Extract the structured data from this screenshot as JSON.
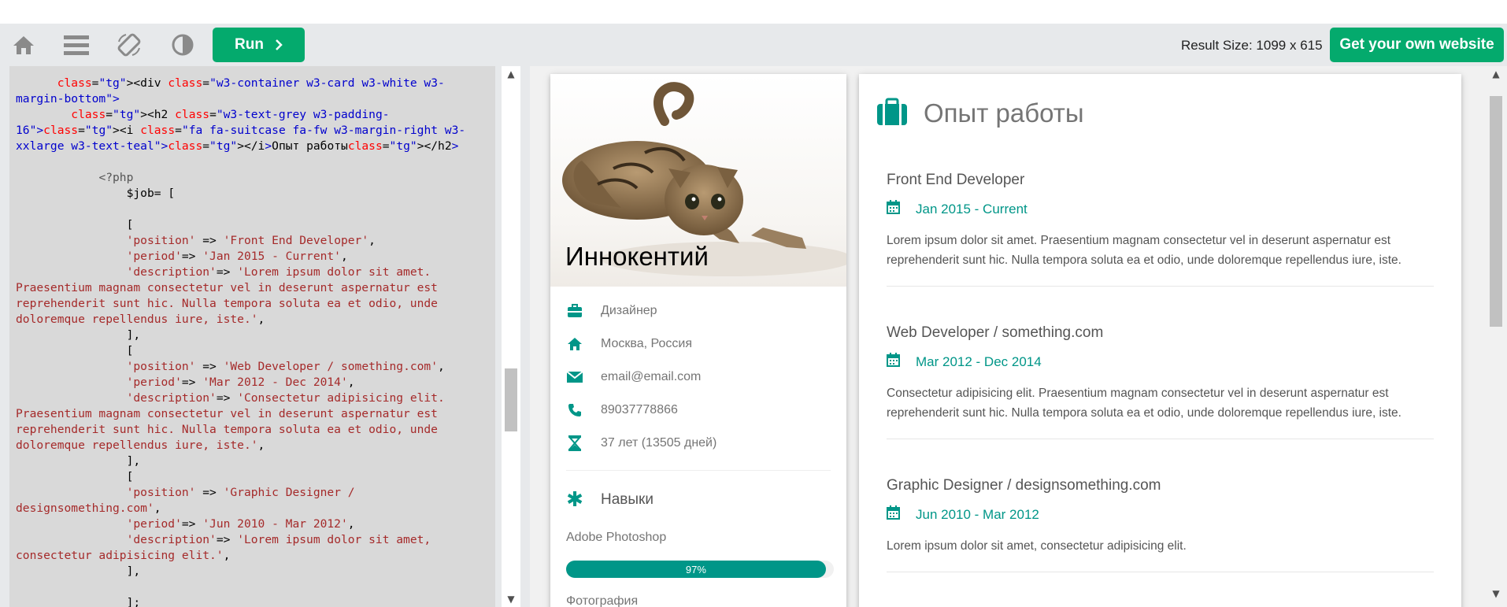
{
  "toolbar": {
    "home_icon": "home-icon",
    "menu_icon": "menu-icon",
    "rotate_icon": "rotate-icon",
    "contrast_icon": "contrast-icon",
    "run_label": "Run",
    "result_size": "Result Size: 1099 x 615",
    "get_website_label": "Get your own website"
  },
  "code": {
    "lines": [
      "      <div class=\"w3-container w3-card w3-white w3-margin-bottom\">",
      "        <h2 class=\"w3-text-grey w3-padding-16\"><i class=\"fa fa-suitcase fa-fw w3-margin-right w3-xxlarge w3-text-teal\"></i>Опыт работы</h2>",
      "",
      "            <?php",
      "                $job= [",
      "",
      "                [",
      "                'position' => 'Front End Developer',",
      "                'period'=> 'Jan 2015 - Current',",
      "                'description'=> 'Lorem ipsum dolor sit amet. Praesentium magnam consectetur vel in deserunt aspernatur est reprehenderit sunt hic. Nulla tempora soluta ea et odio, unde doloremque repellendus iure, iste.',",
      "                ],",
      "                [",
      "                'position' => 'Web Developer / something.com',",
      "                'period'=> 'Mar 2012 - Dec 2014',",
      "                'description'=> 'Consectetur adipisicing elit. Praesentium magnam consectetur vel in deserunt aspernatur est reprehenderit sunt hic. Nulla tempora soluta ea et odio, unde doloremque repellendus iure, iste.',",
      "                ],",
      "                [",
      "                'position' => 'Graphic Designer / designsomething.com',",
      "                'period'=> 'Jun 2010 - Mar 2012',",
      "                'description'=> 'Lorem ipsum dolor sit amet, consectetur adipisicing elit.',",
      "                ],",
      "",
      "                ];"
    ]
  },
  "profile": {
    "name": "Иннокентий",
    "info": [
      {
        "icon": "briefcase-icon",
        "text": "Дизайнер"
      },
      {
        "icon": "home-icon",
        "text": "Москва, Россия"
      },
      {
        "icon": "envelope-icon",
        "text": "email@email.com"
      },
      {
        "icon": "phone-icon",
        "text": "89037778866"
      },
      {
        "icon": "hourglass-icon",
        "text": "37 лет (13505 дней)"
      }
    ],
    "skills_title": "Навыки",
    "skills": [
      {
        "name": "Adobe Photoshop",
        "percent": 97,
        "label": "97%"
      },
      {
        "name": "Фотография"
      }
    ]
  },
  "experience": {
    "title": "Опыт работы",
    "jobs": [
      {
        "position": "Front End Developer",
        "period": "Jan 2015 - Current",
        "description": "Lorem ipsum dolor sit amet. Praesentium magnam consectetur vel in deserunt aspernatur est reprehenderit sunt hic. Nulla tempora soluta ea et odio, unde doloremque repellendus iure, iste."
      },
      {
        "position": "Web Developer / something.com",
        "period": "Mar 2012 - Dec 2014",
        "description": "Consectetur adipisicing elit. Praesentium magnam consectetur vel in deserunt aspernatur est reprehenderit sunt hic. Nulla tempora soluta ea et odio, unde doloremque repellendus iure, iste."
      },
      {
        "position": "Graphic Designer / designsomething.com",
        "period": "Jun 2010 - Mar 2012",
        "description": "Lorem ipsum dolor sit amet, consectetur adipisicing elit."
      }
    ]
  },
  "colors": {
    "accent": "#04aa6d",
    "teal": "#009688",
    "code_bg": "#d9d9d9"
  }
}
